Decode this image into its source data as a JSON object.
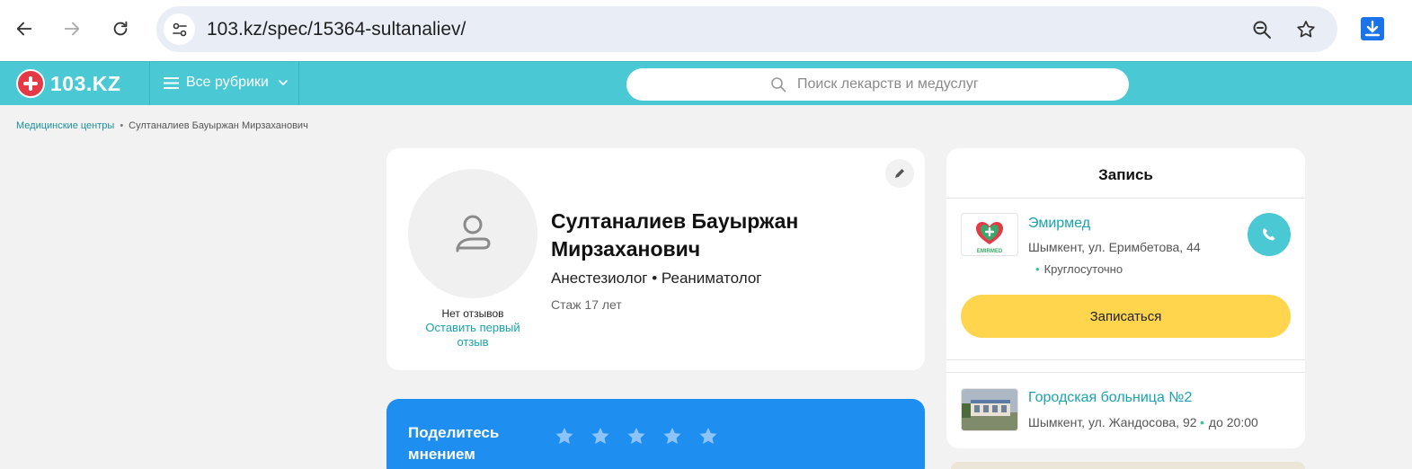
{
  "browser": {
    "url": "103.kz/spec/15364-sultanaliev/"
  },
  "header": {
    "logo_text": "103.KZ",
    "rubrics_label": "Все рубрики",
    "search_placeholder": "Поиск лекарств и медуслуг"
  },
  "breadcrumb": {
    "link": "Медицинские центры",
    "separator": "•",
    "current": "Султаналиев Бауыржан Мирзаханович"
  },
  "profile": {
    "name": "Султаналиев Бауыржан Мирзаханович",
    "specialties": "Анестезиолог • Реаниматолог",
    "experience": "Стаж 17 лет",
    "no_reviews": "Нет отзывов",
    "leave_review": "Оставить первый отзыв"
  },
  "rating": {
    "title": "Поделитесь мнением",
    "stars_count": 5
  },
  "appointment": {
    "title": "Запись",
    "book_label": "Записаться",
    "clinics": [
      {
        "name": "Эмирмед",
        "address": "Шымкент, ул. Еримбетова, 44",
        "hours": "Круглосуточно",
        "logo_text": "EMIRMED"
      },
      {
        "name": "Городская больница №2",
        "address": "Шымкент, ул. Жандосова, 92",
        "hours": "до 20:00"
      }
    ]
  },
  "colors": {
    "brand_teal": "#4ac9d4",
    "link_teal": "#1aa3ad",
    "book_yellow": "#ffd54d",
    "rating_blue": "#1e8ef0",
    "logo_red": "#e53945"
  }
}
